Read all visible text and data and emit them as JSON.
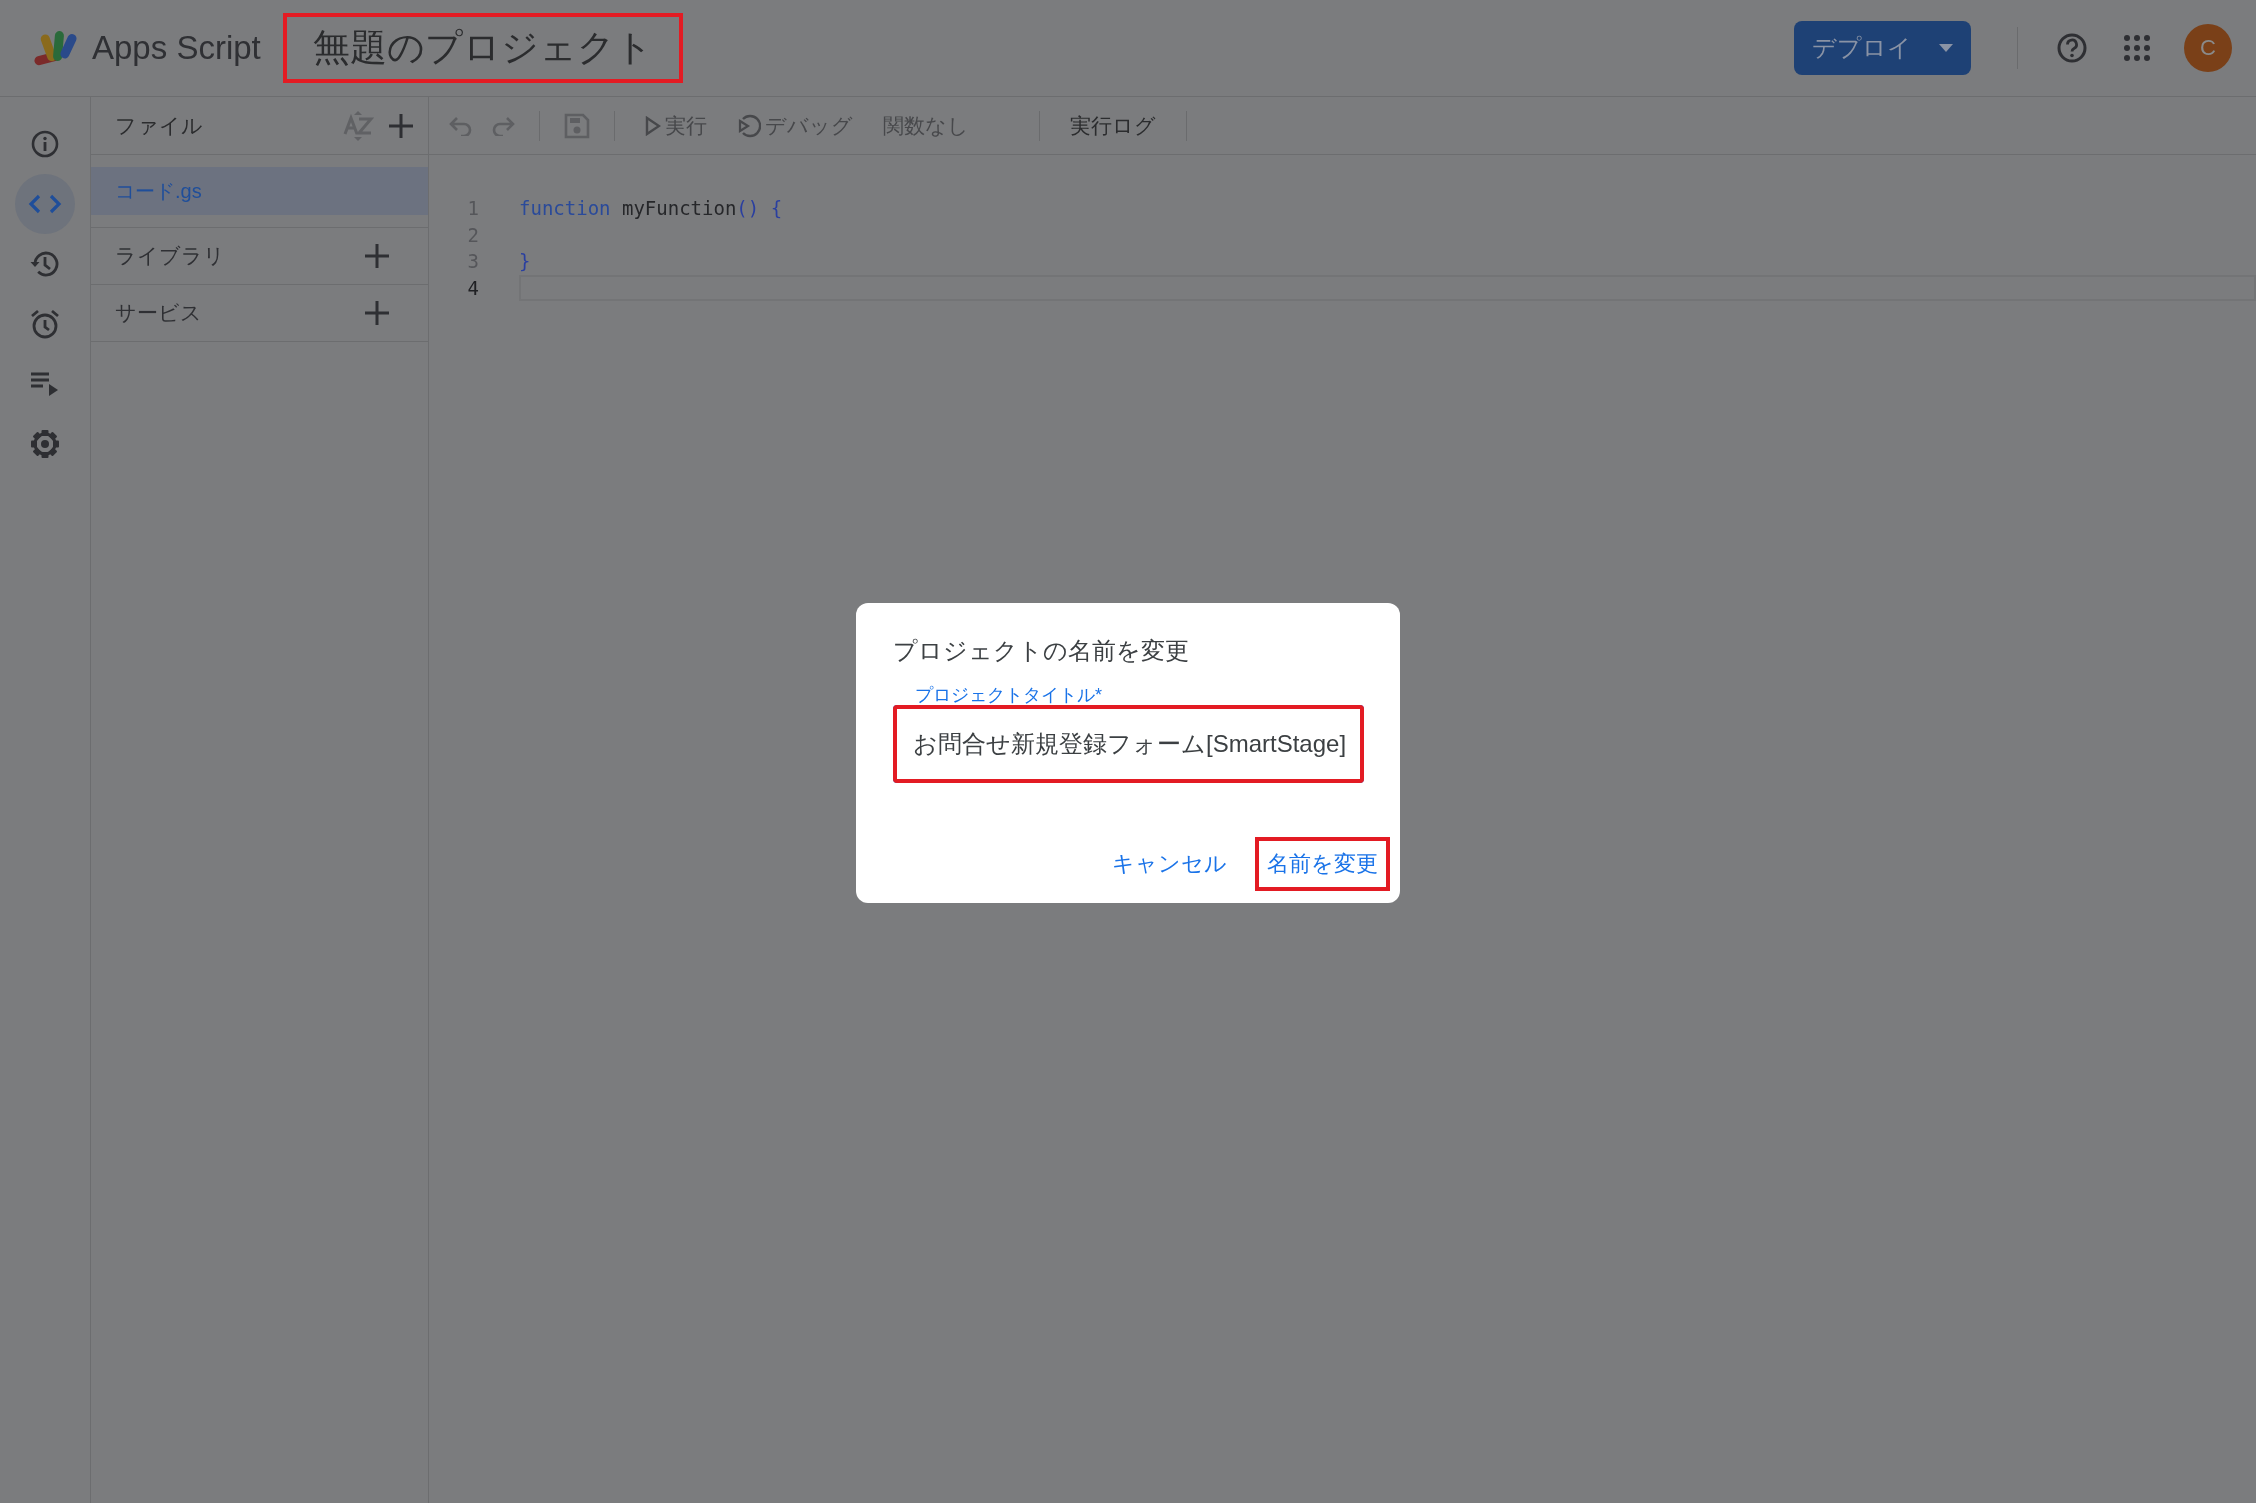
{
  "app": {
    "name": "Apps Script",
    "project_title": "無題のプロジェクト",
    "title_highlighted": true
  },
  "header": {
    "deploy_button": "デプロイ",
    "avatar": "C"
  },
  "rail": [
    {
      "kind": "info",
      "selected": false
    },
    {
      "kind": "code",
      "selected": true
    },
    {
      "kind": "history",
      "selected": false
    },
    {
      "kind": "alarm",
      "selected": false
    },
    {
      "kind": "executions",
      "selected": false
    },
    {
      "kind": "settings",
      "selected": false
    }
  ],
  "files_panel": {
    "title": "ファイル",
    "files": [
      {
        "name": "コード.gs",
        "selected": true
      }
    ],
    "sections": [
      "ライブラリ",
      "サービス"
    ]
  },
  "toolbar": {
    "run": {
      "label": "実行",
      "disabled": true
    },
    "debug": {
      "label": "デバッグ",
      "disabled": true
    },
    "function_select": {
      "label": "関数なし",
      "disabled": true
    },
    "log": {
      "label": "実行ログ",
      "disabled": false
    }
  },
  "editor": {
    "lines": [
      {
        "number": "1",
        "current": false,
        "tokens": [
          {
            "kind": "keyword",
            "text": "function"
          },
          {
            "kind": "plain",
            "text": " myFunction"
          },
          {
            "kind": "punct",
            "text": "() {"
          }
        ]
      },
      {
        "number": "2",
        "current": false
      },
      {
        "number": "3",
        "current": false,
        "tokens": [
          {
            "kind": "punct",
            "text": "}"
          }
        ]
      },
      {
        "number": "4",
        "current": true
      }
    ]
  },
  "dialog": {
    "title": "プロジェクトの名前を変更",
    "field": {
      "label": "プロジェクトタイトル*",
      "value": "お問合せ新規登録フォーム[SmartStage]",
      "highlighted": true
    },
    "buttons": [
      {
        "label": "キャンセル",
        "highlighted": false
      },
      {
        "label": "名前を変更",
        "highlighted": true
      }
    ]
  }
}
